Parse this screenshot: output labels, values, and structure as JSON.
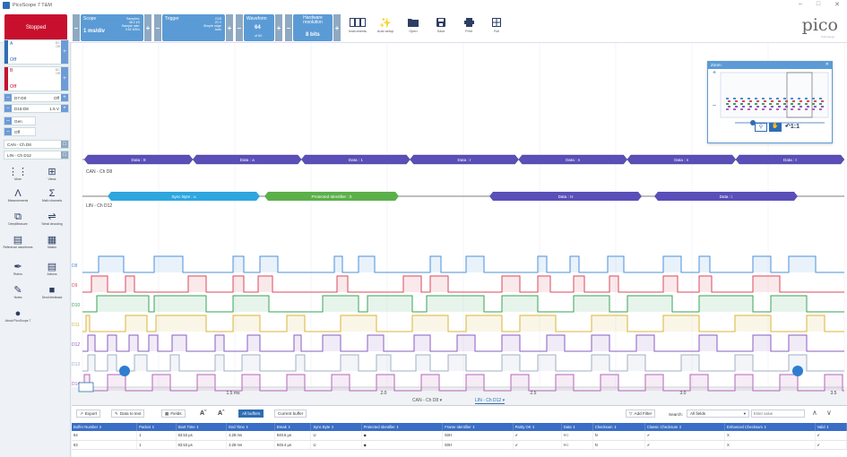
{
  "window": {
    "title": "PicoScope 7 T&M"
  },
  "toolbar": {
    "stop_label": "Stopped",
    "scope": {
      "label": "Scope",
      "value": "1 ms/div",
      "info": [
        "Samples:",
        "48.2 kS",
        "Sample rate:",
        "9.62 MS/s"
      ]
    },
    "trigger": {
      "label": "Trigger",
      "info": [
        "D15",
        "20 V",
        "Simple edge",
        "Auto"
      ]
    },
    "waveform": {
      "label": "Waveform",
      "value": "64",
      "sub": "of 64"
    },
    "hardware": {
      "label": "Hardware resolution",
      "value": "8 bits"
    },
    "tools": [
      {
        "icon": "instruments-icon",
        "label": "Instruments"
      },
      {
        "icon": "auto-setup-icon",
        "label": "Auto setup"
      },
      {
        "icon": "open-icon",
        "label": "Open"
      },
      {
        "icon": "save-icon",
        "label": "Save"
      },
      {
        "icon": "print-icon",
        "label": "Print"
      },
      {
        "icon": "full-screen-icon",
        "label": "Full"
      }
    ],
    "logo": "pico",
    "logo_sub": "Technology"
  },
  "sidebar": {
    "channels": [
      {
        "name": "A",
        "state": "Off",
        "coupling": [
          "DC",
          "Off"
        ],
        "color": "#2e6db4"
      },
      {
        "name": "B",
        "state": "Off",
        "coupling": [
          "DC",
          "Off"
        ],
        "color": "#c8102e"
      }
    ],
    "rows": [
      {
        "label": "D7-D0",
        "value": "Off"
      },
      {
        "label": "D15-D8",
        "value": "1.5 V"
      },
      {
        "label": "Gen",
        "value": ""
      },
      {
        "label": "Off",
        "value": ""
      }
    ],
    "decoders": [
      "CAN - Ch D8",
      "LIN - Ch D12"
    ],
    "buttons": [
      {
        "icon": "more-icon",
        "label": "More"
      },
      {
        "icon": "views-icon",
        "label": "Views"
      },
      {
        "icon": "rulers-icon",
        "label": "Measurements"
      },
      {
        "icon": "math-icon",
        "label": "Math channels"
      },
      {
        "icon": "deepmeasure-icon",
        "label": "DeepMeasure"
      },
      {
        "icon": "serial-decoding-icon",
        "label": "Serial decoding"
      },
      {
        "icon": "reference-icon",
        "label": "Reference waveforms"
      },
      {
        "icon": "masks-icon",
        "label": "Masks"
      },
      {
        "icon": "rulers2-icon",
        "label": "Rulers"
      },
      {
        "icon": "actions-icon",
        "label": "Actions"
      },
      {
        "icon": "notes-icon",
        "label": "Notes"
      },
      {
        "icon": "send-feedback-icon",
        "label": "Send feedback"
      },
      {
        "icon": "about-icon",
        "label": "About PicoScope 7"
      }
    ]
  },
  "scope": {
    "can_label": "CAN - Ch D8",
    "lin_label": "LIN - Ch D12",
    "can_packets": [
      "Data : 8",
      "Data : a",
      "Data : 1",
      "Data : r",
      "Data : n",
      "Data : n",
      "Data : t"
    ],
    "lin_packets": [
      "Sync Byte : u",
      "Protected Identifier : 0",
      "Data : H",
      "Data : i"
    ],
    "digital": [
      {
        "name": "D8",
        "color": "#4a90d9"
      },
      {
        "name": "D9",
        "color": "#d94a5c"
      },
      {
        "name": "D10",
        "color": "#3aa35a"
      },
      {
        "name": "D11",
        "color": "#d9b43a"
      },
      {
        "name": "D12",
        "color": "#8a5cc0"
      },
      {
        "name": "D13",
        "color": "#9fb0c8"
      },
      {
        "name": "D14",
        "color": "#b464b4"
      }
    ],
    "x_ticks": [
      "1.5 ms",
      "2.0",
      "2.5",
      "3.0",
      "3.5"
    ],
    "tabs": [
      "CAN - Ch D8",
      "LIN - Ch D12"
    ]
  },
  "zoom": {
    "title": "Zoom",
    "ratio": "1:1"
  },
  "panel": {
    "buttons": [
      "Export",
      "Data to text",
      "Fields",
      "Aˇ",
      "Aˆ",
      "All buffers",
      "Current buffer"
    ],
    "add_filter": "Add Filter",
    "search_label": "Search:",
    "search_scope": "All fields",
    "search_placeholder": "Enter value",
    "columns": [
      "Buffer Number",
      "Packet",
      "Start Time",
      "End Time",
      "Break",
      "Sync Byte",
      "Protected Identifier",
      "Frame Identifier",
      "Parity OK",
      "Data",
      "Checksum",
      "Classic Checksum",
      "Enhanced Checksum",
      "Valid"
    ],
    "rows": [
      [
        "64",
        "1",
        "83.53 µs",
        "4.28 ms",
        "940.6 µs",
        "U",
        "◆",
        "50H",
        "✔",
        "H i",
        "N",
        "✔",
        "X",
        "✔"
      ],
      [
        "63",
        "1",
        "83.53 µs",
        "4.28 ms",
        "945.4 µs",
        "U",
        "◆",
        "50H",
        "✔",
        "H i",
        "N",
        "✔",
        "X",
        "✔"
      ]
    ]
  }
}
